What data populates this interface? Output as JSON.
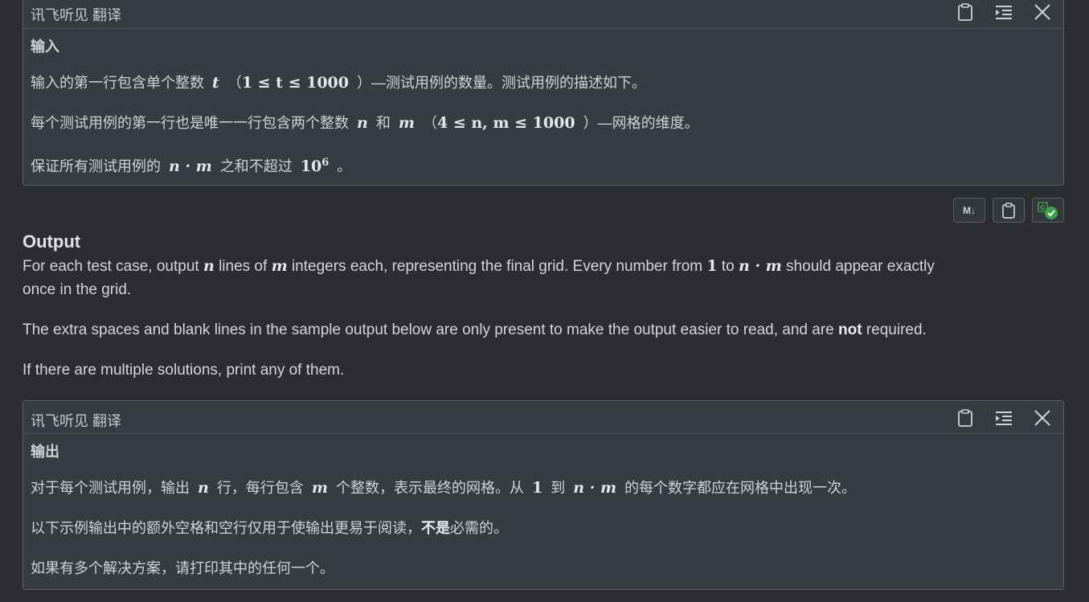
{
  "top_panel": {
    "title": "讯飞听见 翻译",
    "icons": [
      "clipboard-icon",
      "list-indent-icon",
      "close-icon"
    ],
    "heading": "输入",
    "line1": {
      "a": "输入的第一行包含单个整数",
      "var_t": "t",
      "b": "（",
      "expr": "1 ≤ t ≤ 1000",
      "c": "）—测试用例的数量。测试用例的描述如下。"
    },
    "line2": {
      "a": "每个测试用例的第一行也是唯一一行包含两个整数",
      "var_n": "n",
      "b": "和",
      "var_m": "m",
      "c": "（",
      "expr": "4 ≤ n, m ≤ 1000",
      "d": "）—网格的维度。"
    },
    "line3": {
      "a": "保证所有测试用例的",
      "expr": "n · m",
      "b": "之和不超过",
      "pow_base": "10",
      "pow_exp": "6",
      "c": "。"
    }
  },
  "toolbar": {
    "md_label": "M↓",
    "icons": [
      "markdown-icon",
      "clipboard-icon",
      "translate-check-icon"
    ],
    "check_color": "#3aa14a"
  },
  "output": {
    "heading": "Output",
    "p1a_1": "For each test case, output ",
    "p1a_n": "n",
    "p1a_2": " lines of ",
    "p1a_m": "m",
    "p1a_3": " integers each, representing the final grid. Every number from ",
    "p1a_1num": "1",
    "p1a_4": " to ",
    "p1a_nm": "n · m",
    "p1a_5": " should appear exactly",
    "p1b": "once in the grid.",
    "p2a": "The extra spaces and blank lines in the sample output below are only present to make the output easier to read, and are ",
    "p2b": "not",
    "p2c": " required.",
    "p3": "If there are multiple solutions, print any of them."
  },
  "bottom_panel": {
    "title": "讯飞听见 翻译",
    "heading": "输出",
    "line1": {
      "a": "对于每个测试用例，输出",
      "var_n": "n",
      "b": "行，每行包含",
      "var_m": "m",
      "c": "个整数，表示最终的网格。从",
      "one": "1",
      "d": "到",
      "nm": "n · m",
      "e": "的每个数字都应在网格中出现一次。"
    },
    "line2": {
      "a": "以下示例输出中的额外空格和空行仅用于使输出更易于阅读，",
      "b": "不是",
      "c": "必需的。"
    },
    "line3": "如果有多个解决方案，请打印其中的任何一个。"
  }
}
